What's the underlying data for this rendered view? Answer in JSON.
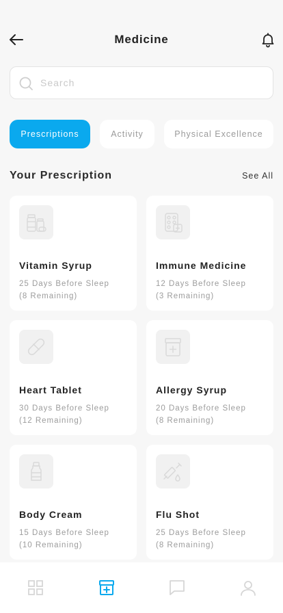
{
  "header": {
    "title": "Medicine",
    "back_icon": "arrow-left-icon",
    "notification_icon": "bell-icon"
  },
  "search": {
    "placeholder": "Search",
    "value": ""
  },
  "tabs": [
    {
      "label": "Prescriptions",
      "active": true
    },
    {
      "label": "Activity",
      "active": false
    },
    {
      "label": "Physical Excellence",
      "active": false
    }
  ],
  "section": {
    "title": "Your Prescription",
    "see_all": "See All"
  },
  "prescriptions": [
    {
      "name": "Vitamin Syrup",
      "schedule": "25 Days Before Sleep",
      "remaining": "(8 Remaining)",
      "icon": "pill-bottles-icon"
    },
    {
      "name": "Immune Medicine",
      "schedule": "12 Days Before Sleep",
      "remaining": "(3 Remaining)",
      "icon": "pill-pack-icon"
    },
    {
      "name": "Heart Tablet",
      "schedule": "30 Days Before Sleep",
      "remaining": "(12 Remaining)",
      "icon": "capsule-icon"
    },
    {
      "name": "Allergy Syrup",
      "schedule": "20 Days Before Sleep",
      "remaining": "(8 Remaining)",
      "icon": "medicine-jar-icon"
    },
    {
      "name": "Body Cream",
      "schedule": "15 Days Before Sleep",
      "remaining": "(10 Remaining)",
      "icon": "lotion-bottle-icon"
    },
    {
      "name": "Flu Shot",
      "schedule": "25 Days Before Sleep",
      "remaining": "(8 Remaining)",
      "icon": "syringe-icon"
    }
  ],
  "bottom_nav": [
    {
      "icon": "grid-icon",
      "active": false
    },
    {
      "icon": "medicine-box-icon",
      "active": true
    },
    {
      "icon": "chat-icon",
      "active": false
    },
    {
      "icon": "user-icon",
      "active": false
    }
  ],
  "colors": {
    "accent": "#0aa9ee",
    "background": "#f7f7f7",
    "card": "#ffffff",
    "muted_text": "#9c9c9c"
  }
}
